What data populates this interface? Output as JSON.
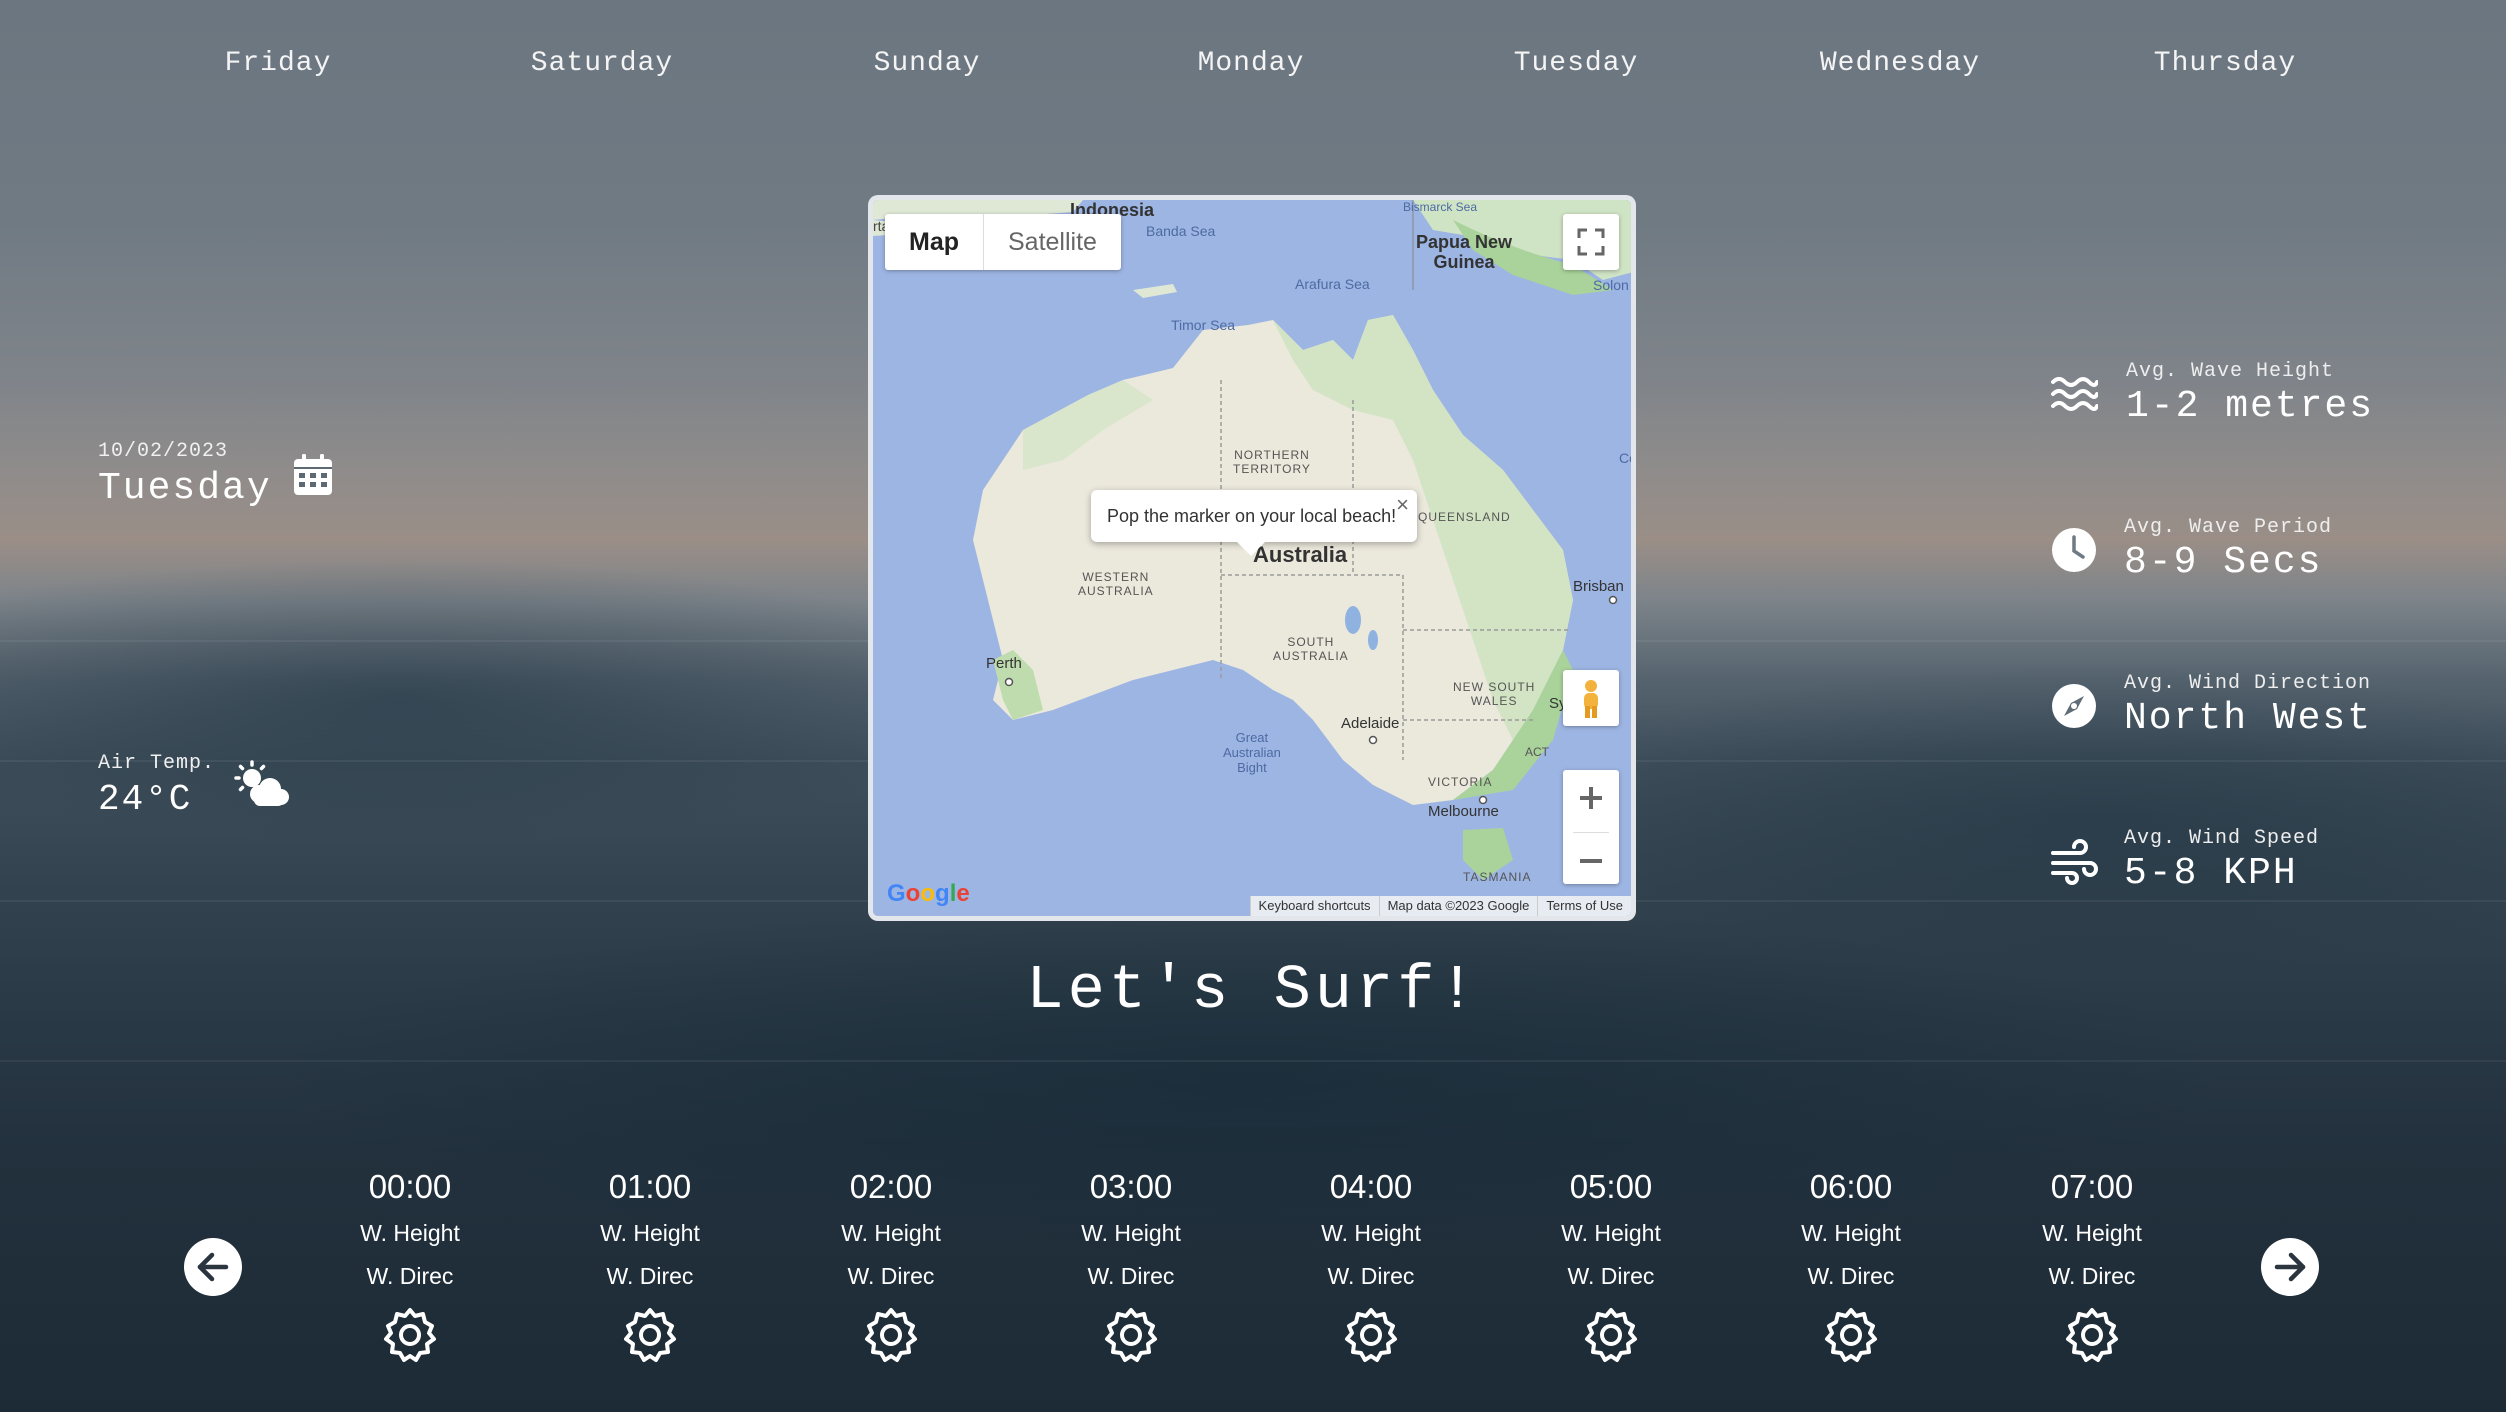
{
  "days": [
    "Friday",
    "Saturday",
    "Sunday",
    "Monday",
    "Tuesday",
    "Wednesday",
    "Thursday"
  ],
  "date": {
    "short": "10/02/2023",
    "weekday": "Tuesday",
    "icon": "calendar-icon"
  },
  "air_temp": {
    "label": "Air Temp.",
    "value": "24°C",
    "icon": "partly-sunny-icon"
  },
  "map": {
    "toggle_map": "Map",
    "toggle_satellite": "Satellite",
    "info_window": "Pop the marker on your local beach!",
    "info_close": "×",
    "labels": {
      "indonesia": "Indonesia",
      "banda_sea": "Banda Sea",
      "arafura_sea": "Arafura Sea",
      "timor_sea": "Timor Sea",
      "papua_new_guinea": "Papua New\nGuinea",
      "northern_territory": "NORTHERN\nTERRITORY",
      "queensland": "QUEENSLAND",
      "western_australia": "WESTERN\nAUSTRALIA",
      "australia": "Australia",
      "south_australia": "SOUTH\nAUSTRALIA",
      "new_south_wales": "NEW SOUTH\nWALES",
      "perth": "Perth",
      "adelaide": "Adelaide",
      "great_australian_bight": "Great\nAustralian\nBight",
      "victoria": "VICTORIA",
      "melbourne": "Melbourne",
      "tasmania": "TASMANIA",
      "act": "ACT",
      "brisbane": "Brisban",
      "bismarck_sea": "Bismarck Sea",
      "solomon": "Solon",
      "sy": "Sy",
      "partial_left": "rta",
      "partial_c": "Co"
    },
    "attribution": {
      "keyboard": "Keyboard shortcuts",
      "data": "Map data ©2023 Google",
      "terms": "Terms of Use"
    },
    "logo": "Google"
  },
  "tagline": "Let's Surf!",
  "stats": [
    {
      "label": "Avg. Wave Height",
      "value": "1-2 metres",
      "icon": "waves-icon"
    },
    {
      "label": "Avg. Wave Period",
      "value": "8-9 Secs",
      "icon": "clock-icon"
    },
    {
      "label": "Avg. Wind Direction",
      "value": "North West",
      "icon": "compass-icon"
    },
    {
      "label": "Avg. Wind Speed",
      "value": "5-8 KPH",
      "icon": "wind-icon"
    }
  ],
  "hourly": [
    {
      "time": "00:00",
      "height_label": "W. Height",
      "dir_label": "W. Direc"
    },
    {
      "time": "01:00",
      "height_label": "W. Height",
      "dir_label": "W. Direc"
    },
    {
      "time": "02:00",
      "height_label": "W. Height",
      "dir_label": "W. Direc"
    },
    {
      "time": "03:00",
      "height_label": "W. Height",
      "dir_label": "W. Direc"
    },
    {
      "time": "04:00",
      "height_label": "W. Height",
      "dir_label": "W. Direc"
    },
    {
      "time": "05:00",
      "height_label": "W. Height",
      "dir_label": "W. Direc"
    },
    {
      "time": "06:00",
      "height_label": "W. Height",
      "dir_label": "W. Direc"
    },
    {
      "time": "07:00",
      "height_label": "W. Height",
      "dir_label": "W. Direc"
    }
  ],
  "nav": {
    "prev_icon": "arrow-left-icon",
    "next_icon": "arrow-right-icon"
  }
}
